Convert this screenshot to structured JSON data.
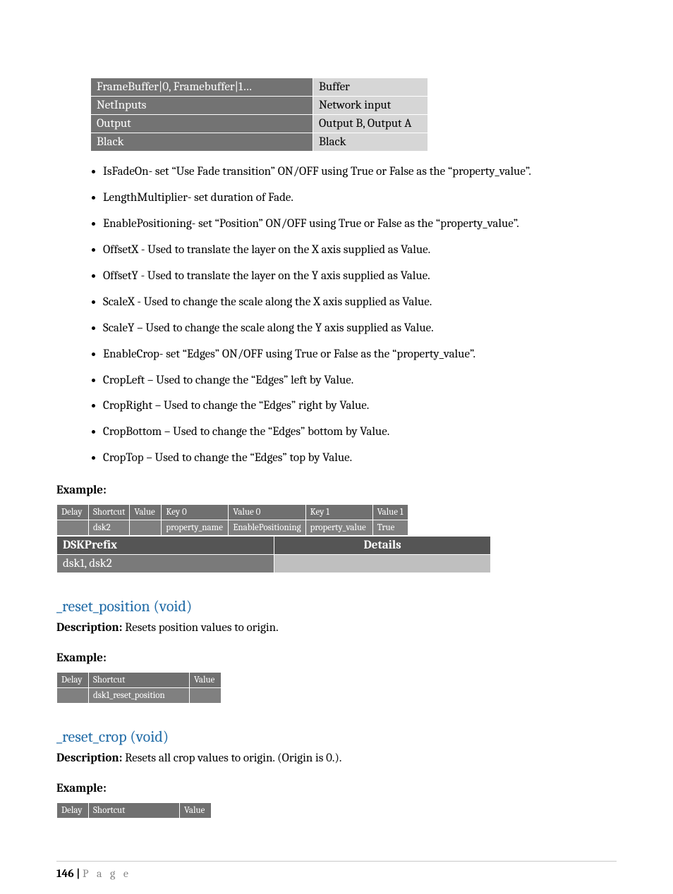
{
  "table1": {
    "rows": [
      {
        "left": "FrameBuffer|0, Framebuffer|1…",
        "right": "Buffer"
      },
      {
        "left": "NetInputs",
        "right": "Network input"
      },
      {
        "left": "Output",
        "right": "Output B, Output A"
      },
      {
        "left": "Black",
        "right": "Black"
      }
    ]
  },
  "bullets": [
    "IsFadeOn- set “Use Fade transition” ON/OFF using True or False as the “property_value”.",
    "LengthMultiplier- set duration of Fade.",
    "EnablePositioning- set “Position” ON/OFF using True or False as the “property_value”.",
    "OffsetX - Used to translate the layer on the X axis supplied as Value.",
    "OffsetY - Used to translate the layer on the Y axis supplied as Value.",
    "ScaleX - Used to change the scale along the X axis supplied as Value.",
    "ScaleY – Used to change the scale along the Y axis supplied as Value.",
    "EnableCrop- set “Edges” ON/OFF using True or False as the “property_value”.",
    "CropLeft – Used to change the “Edges” left by Value.",
    "CropRight – Used to change the “Edges” right by Value.",
    "CropBottom – Used to change the “Edges” bottom by Value.",
    "CropTop – Used to change the “Edges” top by Value."
  ],
  "example_label": "Example:",
  "example1": {
    "headers": [
      "Delay",
      "Shortcut",
      "Value",
      "Key 0",
      "Value 0",
      "Key 1",
      "Value 1"
    ],
    "row": [
      "",
      "dsk2",
      "",
      "property_name",
      "EnablePositioning",
      "property_value",
      "True"
    ]
  },
  "dsk": {
    "h_left": "DSKPrefix",
    "h_right": "Details",
    "b_left": "dsk1, dsk2",
    "b_right": ""
  },
  "sec1": {
    "title": "_reset_position (void)",
    "desc_label": "Description:",
    "desc_text": " Resets position values to origin.",
    "ex_label": "Example:",
    "table": {
      "headers": [
        "Delay",
        "Shortcut",
        "Value"
      ],
      "row": [
        "",
        "dsk1_reset_position",
        ""
      ]
    }
  },
  "sec2": {
    "title": "_reset_crop (void)",
    "desc_label": "Description:",
    "desc_text": " Resets all crop values to origin.  (Origin is 0.).",
    "ex_label": "Example:",
    "table": {
      "headers": [
        "Delay",
        "Shortcut",
        "Value"
      ]
    }
  },
  "footer": {
    "num": "146 | ",
    "word": "P a g e"
  }
}
